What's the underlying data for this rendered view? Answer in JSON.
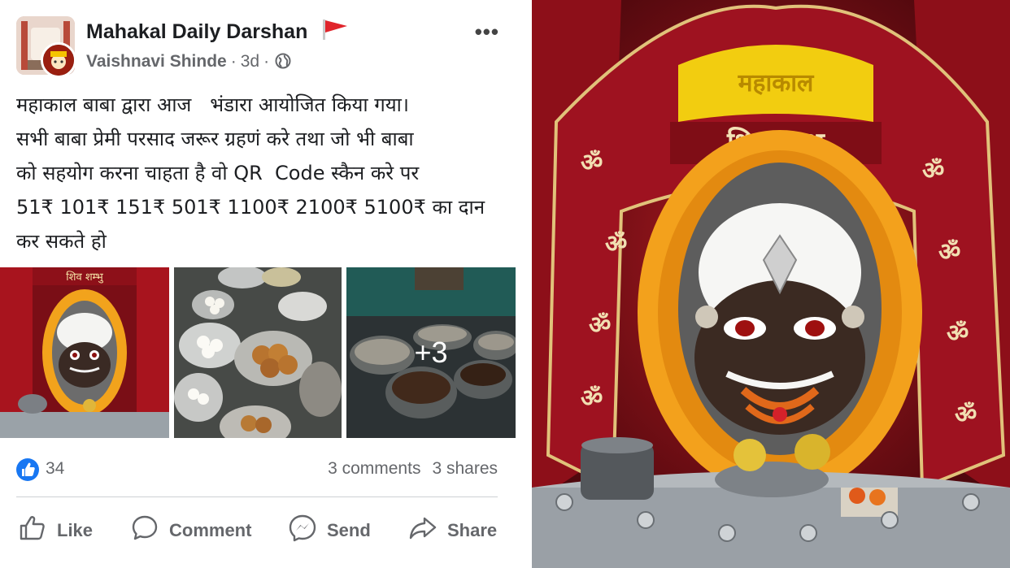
{
  "post": {
    "page_name": "Mahakal Daily Darshan",
    "author": "Vaishnavi Shinde",
    "time_ago": "3d",
    "text": "महाकाल बाबा द्वारा आज   भंडारा आयोजित किया गया।\nसभी बाबा प्रेमी परसाद जरूर ग्रहणं करे तथा जो भी बाबा\nको सहयोग करना चाहता है वो QR  Code स्कैन करे पर\n51₹ 101₹ 151₹ 501₹ 1100₹ 2100₹ 5100₹ का दान\nकर सकते हो",
    "more_photos": "+3",
    "photo_overlay_text": {
      "cloth_top": "महाकाल",
      "cloth_band": "शिव शम्भु",
      "thumb_cloth": "शिव शम्भु"
    }
  },
  "stats": {
    "reactions": "34",
    "comments": "3 comments",
    "shares": "3 shares"
  },
  "actions": {
    "like": "Like",
    "comment": "Comment",
    "send": "Send",
    "share": "Share"
  },
  "colors": {
    "facebook_blue": "#1877f2",
    "text_primary": "#1c1e21",
    "text_secondary": "#65676b",
    "flag_red": "#e0242b"
  },
  "icons": [
    "more-options-icon",
    "flag-icon",
    "globe-icon",
    "like-reaction-icon",
    "thumbs-up-icon",
    "comment-icon",
    "messenger-icon",
    "share-arrow-icon"
  ]
}
